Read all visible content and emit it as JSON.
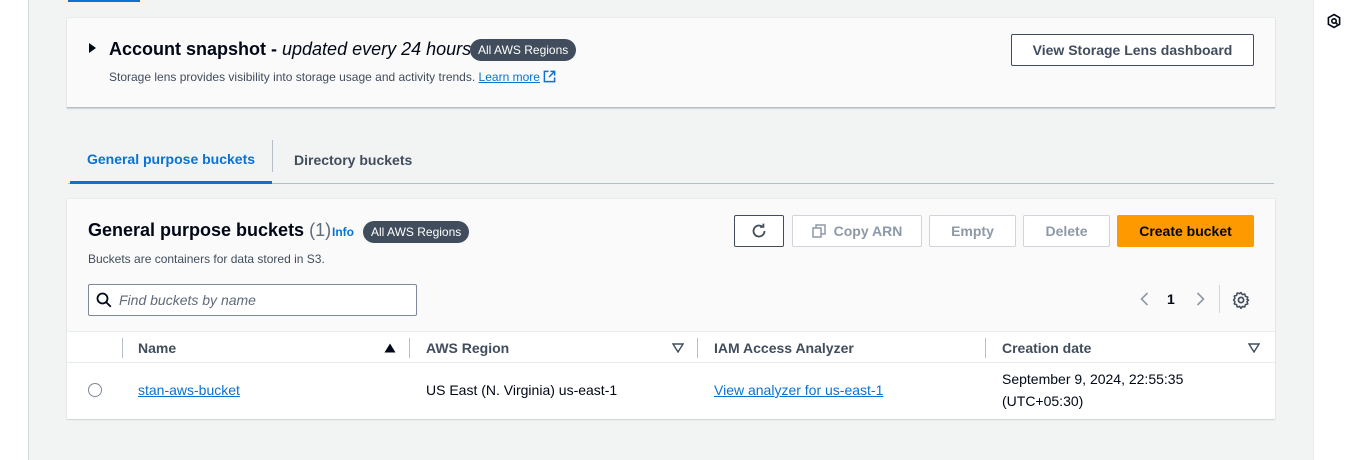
{
  "snapshot": {
    "title_bold": "Account snapshot - ",
    "title_italic": "updated every 24 hours",
    "badge": "All AWS Regions",
    "description": "Storage lens provides visibility into storage usage and activity trends.",
    "learn_more": "Learn more",
    "dashboard_button": "View Storage Lens dashboard"
  },
  "tabs": [
    {
      "label": "General purpose buckets",
      "active": true
    },
    {
      "label": "Directory buckets",
      "active": false
    }
  ],
  "buckets": {
    "title": "General purpose buckets",
    "count": "(1)",
    "info": "Info",
    "badge": "All AWS Regions",
    "description": "Buckets are containers for data stored in S3.",
    "actions": {
      "copy_arn": "Copy ARN",
      "empty": "Empty",
      "delete": "Delete",
      "create": "Create bucket"
    },
    "search_placeholder": "Find buckets by name",
    "page": "1",
    "columns": [
      "Name",
      "AWS Region",
      "IAM Access Analyzer",
      "Creation date"
    ],
    "rows": [
      {
        "name": "stan-aws-bucket",
        "region": "US East (N. Virginia) us-east-1",
        "analyzer": "View analyzer for us-east-1",
        "created_line1": "September 9, 2024, 22:55:35",
        "created_line2": "(UTC+05:30)"
      }
    ]
  },
  "icons": [
    "caret-right-icon",
    "external-link-icon",
    "refresh-icon",
    "copy-icon",
    "search-icon",
    "chevron-left-icon",
    "chevron-right-icon",
    "settings-icon",
    "sort-ascending-icon",
    "sort-icon",
    "rail-icon"
  ],
  "colors": {
    "primary": "#ff9900",
    "link": "#0972d3",
    "badge": "#414d5c"
  }
}
